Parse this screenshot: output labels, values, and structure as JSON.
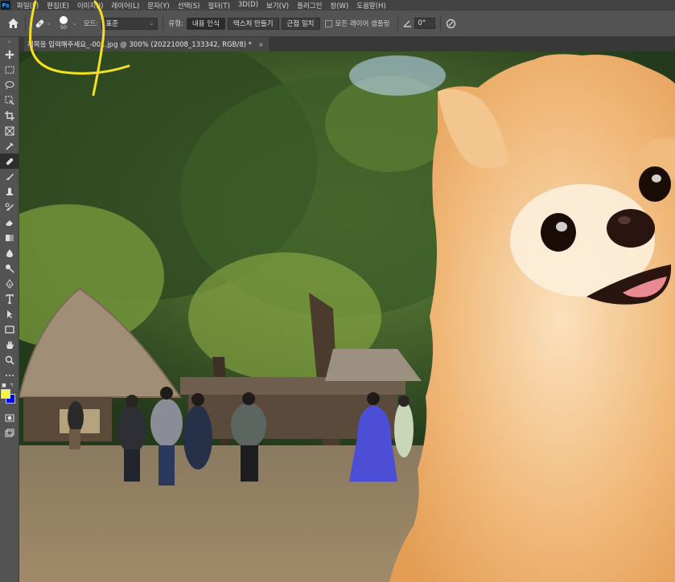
{
  "menubar": {
    "logo": "Ps",
    "items": [
      "파일(F)",
      "편집(E)",
      "이미지(I)",
      "레이어(L)",
      "문자(Y)",
      "선택(S)",
      "필터(T)",
      "3D(D)",
      "보기(V)",
      "플러그인",
      "창(W)",
      "도움말(H)"
    ]
  },
  "options": {
    "brush_size": "50",
    "mode_label": "모드:",
    "mode_value": "표준",
    "type_label": "유형:",
    "type_buttons": [
      "내용 인식",
      "텍스처 만들기",
      "근접 일치"
    ],
    "type_active_index": 0,
    "sample_all_layers_label": "모든 레이어 샘플링",
    "sample_all_layers_checked": false,
    "angle_value": "0°"
  },
  "document": {
    "tab_title": "제목을 입력해주세요_-001.jpg @ 300% (20221008_133342, RGB/8) *",
    "close_glyph": "×"
  },
  "toolbar": {
    "tools": [
      "move-tool",
      "marquee-tool",
      "lasso-tool",
      "object-select-tool",
      "crop-tool",
      "frame-tool",
      "eyedropper-tool",
      "spot-healing-brush-tool",
      "brush-tool",
      "clone-stamp-tool",
      "history-brush-tool",
      "eraser-tool",
      "gradient-tool",
      "blur-tool",
      "dodge-tool",
      "pen-tool",
      "type-tool",
      "path-select-tool",
      "rectangle-tool",
      "hand-tool",
      "zoom-tool",
      "more-tools"
    ],
    "active_tool": "spot-healing-brush-tool",
    "foreground_color": "#f5f542",
    "background_color": "#0000ff"
  },
  "colors": {
    "annotation": "#f5e020",
    "ps_accent": "#31a8ff"
  }
}
